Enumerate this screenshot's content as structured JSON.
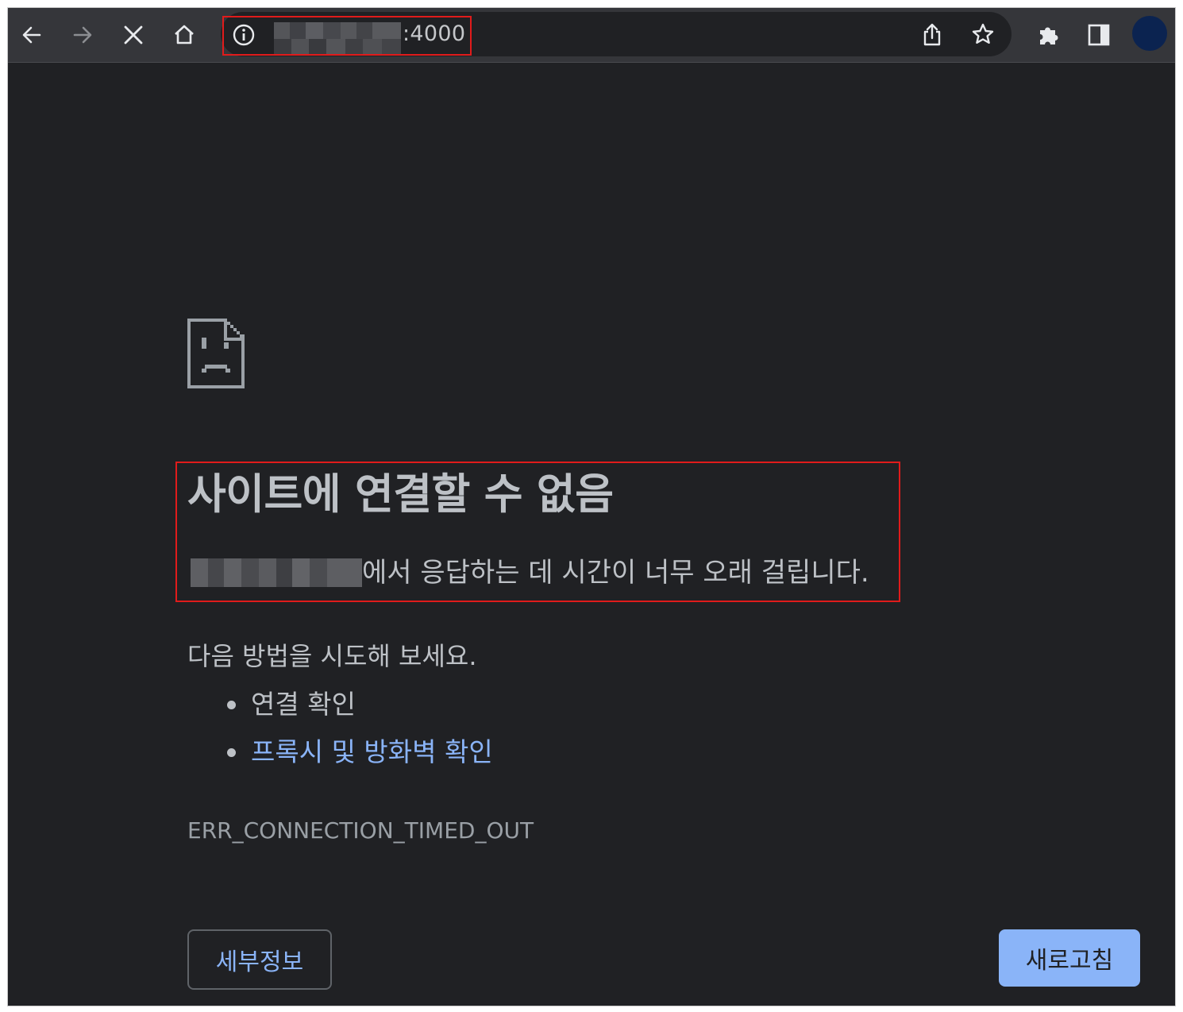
{
  "toolbar": {
    "back_icon": "arrow-left-icon",
    "forward_icon": "arrow-right-icon",
    "stop_icon": "close-icon",
    "home_icon": "home-icon",
    "address": {
      "info_icon": "info-icon",
      "port_text": ":4000"
    },
    "share_icon": "share-icon",
    "bookmark_icon": "star-icon",
    "extensions_icon": "puzzle-icon",
    "sidepanel_icon": "side-panel-icon"
  },
  "error": {
    "icon": "sad-page-icon",
    "title": "사이트에 연결할 수 없음",
    "subtitle_suffix": "에서 응답하는 데 시간이 너무 오래 걸립니다.",
    "try_heading": "다음 방법을 시도해 보세요.",
    "suggestions": [
      {
        "label": "연결 확인",
        "is_link": false
      },
      {
        "label": "프록시 및 방화벽 확인",
        "is_link": true
      }
    ],
    "code": "ERR_CONNECTION_TIMED_OUT",
    "details_label": "세부정보",
    "reload_label": "새로고침"
  },
  "colors": {
    "page_bg": "#202124",
    "toolbar_bg": "#35363a",
    "text": "#bdc1c6",
    "link": "#8ab4f8",
    "highlight": "#e01b1b"
  }
}
